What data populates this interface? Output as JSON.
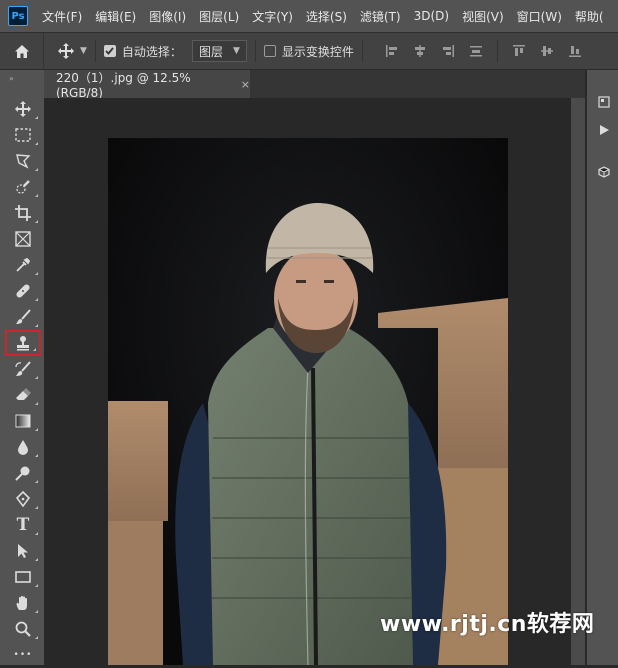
{
  "app": {
    "logo_text": "Ps"
  },
  "menu": [
    "文件(F)",
    "编辑(E)",
    "图像(I)",
    "图层(L)",
    "文字(Y)",
    "选择(S)",
    "滤镜(T)",
    "3D(D)",
    "视图(V)",
    "窗口(W)",
    "帮助("
  ],
  "options": {
    "auto_select_label": "自动选择：",
    "auto_select_checked": true,
    "auto_select_target": "图层",
    "show_transform_label": "显示变换控件",
    "show_transform_checked": false
  },
  "document": {
    "tab_title": "220（1）.jpg @ 12.5%(RGB/8)",
    "close_glyph": "×"
  },
  "tools": [
    "move-tool",
    "marquee-tool",
    "lasso-tool",
    "quick-select-tool",
    "crop-tool",
    "frame-tool",
    "eyedropper-tool",
    "healing-brush-tool",
    "brush-tool",
    "clone-stamp-tool",
    "history-brush-tool",
    "eraser-tool",
    "gradient-tool",
    "blur-tool",
    "dodge-tool",
    "pen-tool",
    "type-tool",
    "path-select-tool",
    "rectangle-tool",
    "hand-tool",
    "zoom-tool",
    "more-tools"
  ],
  "active_tool": "clone-stamp-tool",
  "colors": {
    "active_tool_outline": "#c8282a",
    "menubar": "#535353",
    "canvas_bg": "#282828"
  },
  "watermark": {
    "text": "www.rjtj.cn软荐网"
  },
  "type_tool_glyph": "T",
  "more_glyph": "•••",
  "collapse_glyph": "»"
}
